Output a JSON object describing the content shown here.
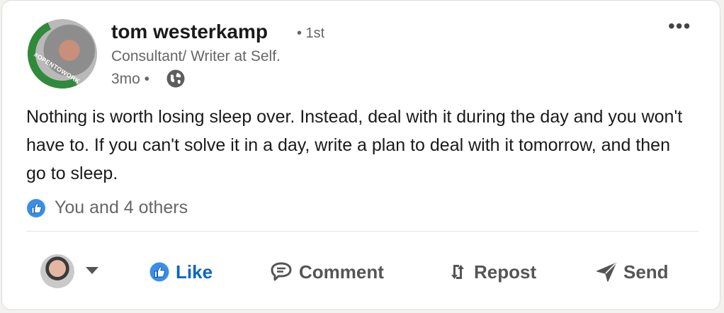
{
  "post": {
    "author": {
      "name": "tom westerkamp",
      "connection_degree": "• 1st",
      "headline": "Consultant/ Writer at Self.",
      "time_ago": "3mo •",
      "avatar_badge": "#OPENTOWORK",
      "badge_color": "#2f8b3a"
    },
    "body": "Nothing is worth losing sleep over. Instead, deal with it during the day and you won't have to. If you can't solve it in a day, write a plan to deal with it tomorrow, and then go to sleep.",
    "reactions_text": "You and 4 others",
    "more_icon": "•••",
    "visibility_icon": "globe-icon"
  },
  "actions": {
    "like_label": "Like",
    "comment_label": "Comment",
    "repost_label": "Repost",
    "send_label": "Send",
    "like_color": "#0a66c2",
    "muted_color": "#555555"
  }
}
